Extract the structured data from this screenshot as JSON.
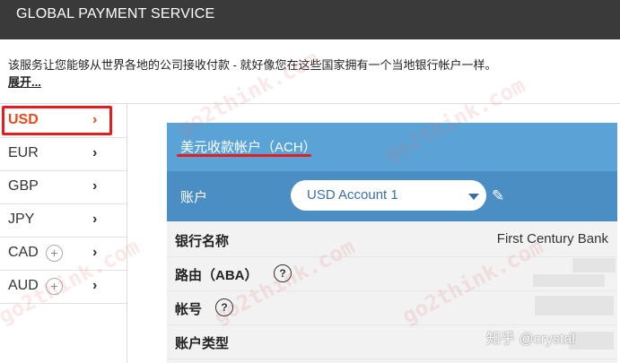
{
  "header": {
    "title": "GLOBAL PAYMENT SERVICE"
  },
  "intro": {
    "description": "该服务让您能够从世界各地的公司接收付款 - 就好像您在这些国家拥有一个当地银行帐户一样。",
    "expand_link": "展开..."
  },
  "sidebar": {
    "items": [
      {
        "label": "USD",
        "chevron": "›",
        "active": true,
        "addable": false
      },
      {
        "label": "EUR",
        "chevron": "›",
        "active": false,
        "addable": false
      },
      {
        "label": "GBP",
        "chevron": "›",
        "active": false,
        "addable": false
      },
      {
        "label": "JPY",
        "chevron": "›",
        "active": false,
        "addable": false
      },
      {
        "label": "CAD",
        "chevron": "›",
        "active": false,
        "addable": true,
        "add_symbol": "+"
      },
      {
        "label": "AUD",
        "chevron": "›",
        "active": false,
        "addable": true,
        "add_symbol": "+"
      }
    ]
  },
  "panel": {
    "title": "美元收款帐户（ACH）",
    "account_label": "账户",
    "account_value": "USD Account 1",
    "edit_icon": "pencil-icon",
    "rows": [
      {
        "key": "银行名称",
        "value": "First Century Bank",
        "has_help": false
      },
      {
        "key": "路由（ABA）",
        "value": "",
        "has_help": true,
        "help_symbol": "?"
      },
      {
        "key": "帐号",
        "value": "",
        "has_help": true,
        "help_symbol": "?"
      },
      {
        "key": "账户类型",
        "value": "",
        "has_help": false
      }
    ]
  },
  "watermark": {
    "text": "go2think.com"
  },
  "credit": {
    "text": "知乎 @crystal"
  },
  "colors": {
    "topbar": "#3a3a3a",
    "active_tab": "#e8491d",
    "highlight": "#e41e1e",
    "panel_header": "#5aa3d6",
    "account_row": "#4a8ec4"
  }
}
